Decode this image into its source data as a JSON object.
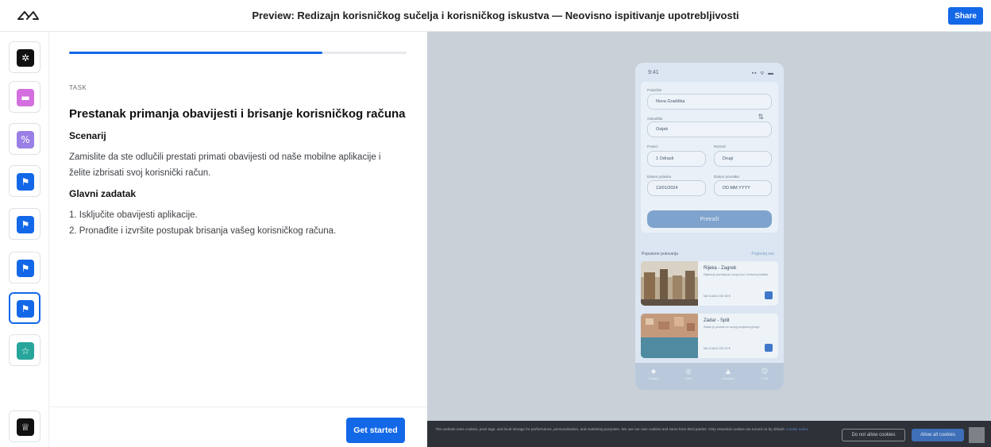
{
  "header": {
    "title": "Preview: Redizajn korisničkog sučelja i korisničkog iskustva — Neovisno ispitivanje upotrebljivosti",
    "share_label": "Share"
  },
  "rail": {
    "items": [
      {
        "icon": "settings-icon",
        "color": "#111111",
        "glyph": "✲"
      },
      {
        "icon": "message-icon",
        "color": "#d46fe0",
        "glyph": "▬"
      },
      {
        "icon": "percent-icon",
        "color": "#9a7fe6",
        "glyph": "%"
      },
      {
        "icon": "flag-icon",
        "color": "#1368e8",
        "glyph": "⚑"
      },
      {
        "icon": "flag-icon",
        "color": "#1368e8",
        "glyph": "⚑"
      },
      {
        "icon": "flag-icon",
        "color": "#1368e8",
        "glyph": "⚑"
      },
      {
        "icon": "flag-icon",
        "color": "#1368e8",
        "glyph": "⚑",
        "active": true
      },
      {
        "icon": "star-icon",
        "color": "#27a59b",
        "glyph": "☆"
      },
      {
        "icon": "trophy-icon",
        "color": "#111111",
        "glyph": "♕"
      }
    ]
  },
  "task": {
    "progress": 0.75,
    "eyebrow": "TASK",
    "title": "Prestanak primanja obavijesti i brisanje korisničkog računa",
    "scenario_heading": "Scenarij",
    "scenario_text": "Zamislite da ste odlučili prestati primati obavijesti od naše mobilne aplikacije i želite izbrisati svoj korisnički račun.",
    "main_task_heading": "Glavni zadatak",
    "steps": [
      "1. Isključite obavijesti aplikacije.",
      "2. Pronađite i izvršite postupak brisanja vašeg korisničkog računa."
    ],
    "start_label": "Get started"
  },
  "phone": {
    "time": "9:41",
    "signal": "▪▪ ᯤ ▬",
    "from_label": "Polazište",
    "from_value": "Nova Gradiška",
    "to_label": "Odredište",
    "to_value": "Osijek",
    "passengers_label": "Putnici",
    "passengers_value": "1 Odrasli",
    "class_label": "Razred",
    "class_value": "Drugi",
    "depart_label": "Datum polaska",
    "depart_value": "13/01/2024",
    "return_label": "Datum povratka",
    "return_value": "DD.MM.YYYY",
    "search_label": "Pretraži",
    "popular_heading": "Popularne putovanja",
    "see_all": "Pogledaj sve",
    "routes": [
      {
        "title": "Rijeka - Zagreb",
        "desc": "Rijeka je poznata po svojoj luci i kulturnoj baštini",
        "price": "NA VLAKU OD 15 €"
      },
      {
        "title": "Zadar - Split",
        "desc": "Zadar je poznat po svojoj povijesnoj jezgri",
        "price": "NA VLAKU OD 20 €"
      }
    ],
    "tabs": [
      "Početna",
      "Karte",
      "Obavijesti",
      "Profil"
    ]
  },
  "cookie": {
    "text": "This website uses cookies, pixel tags, and local storage for performance, personalization, and marketing purposes. We use our own cookies and some from third parties. Only essential cookies are turned on by default.",
    "link": "Cookie notice",
    "deny_label": "Do not allow cookies",
    "allow_label": "Allow all cookies"
  }
}
